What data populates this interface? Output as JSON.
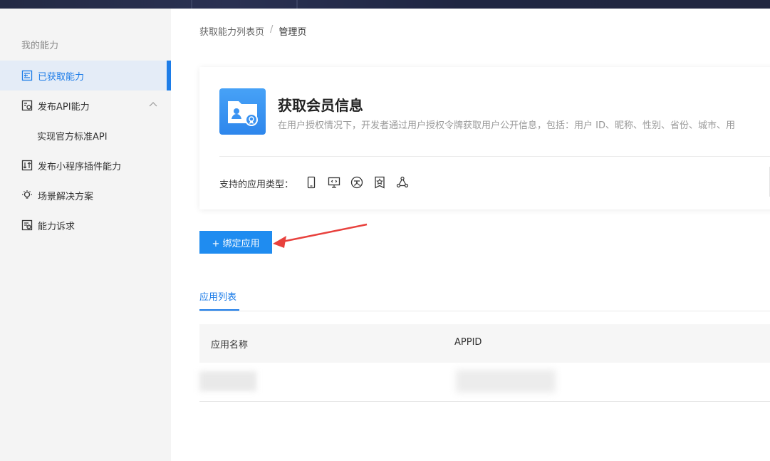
{
  "sidebar": {
    "group_title": "我的能力",
    "items": [
      {
        "label": "已获取能力",
        "active": true
      },
      {
        "label": "发布API能力",
        "expanded": true
      },
      {
        "label": "实现官方标准API",
        "sub": true
      },
      {
        "label": "发布小程序插件能力"
      },
      {
        "label": "场景解决方案"
      },
      {
        "label": "能力诉求"
      }
    ]
  },
  "breadcrumb": {
    "parent": "获取能力列表页",
    "separator": "/",
    "current": "管理页"
  },
  "card": {
    "title": "获取会员信息",
    "description": "在用户授权情况下，开发者通过用户授权令牌获取用户公开信息，包括：用户 ID、昵称、性别、省份、城市、用",
    "supported_types_label": "支持的应用类型：",
    "type_icons": [
      "mobile-app-icon",
      "web-app-icon",
      "mini-program-icon",
      "life-account-icon",
      "cloud-share-icon"
    ]
  },
  "actions": {
    "bind_button": "+ 绑定应用"
  },
  "tabs": {
    "app_list": "应用列表"
  },
  "table": {
    "columns": [
      "应用名称",
      "APPID"
    ]
  },
  "colors": {
    "accent": "#1c7ce8",
    "button": "#1f8cf0",
    "annotation_arrow": "#e8413d"
  }
}
